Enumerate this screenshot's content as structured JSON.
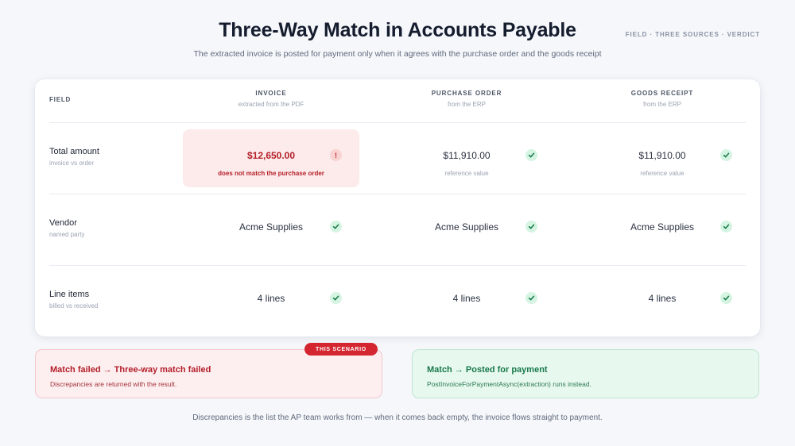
{
  "header": {
    "title": "Three-Way Match in Accounts Payable",
    "subtitle": "The extracted invoice is posted for payment only when it agrees with the purchase order and the goods receipt",
    "crumbs": "FIELD · THREE SOURCES · VERDICT"
  },
  "table": {
    "field_header": "FIELD",
    "columns": [
      {
        "name": "INVOICE",
        "sub": "extracted from the PDF"
      },
      {
        "name": "PURCHASE ORDER",
        "sub": "from the ERP"
      },
      {
        "name": "GOODS RECEIPT",
        "sub": "from the ERP"
      }
    ],
    "rows": [
      {
        "label": "Total amount",
        "hint": "invoice vs order",
        "cells": [
          {
            "value": "$12,650.00",
            "note": "does not match the purchase order",
            "status": "mismatch"
          },
          {
            "value": "$11,910.00",
            "note": "reference value",
            "status": "match"
          },
          {
            "value": "$11,910.00",
            "note": "reference value",
            "status": "match"
          }
        ]
      },
      {
        "label": "Vendor",
        "hint": "named party",
        "cells": [
          {
            "value": "Acme Supplies",
            "status": "match"
          },
          {
            "value": "Acme Supplies",
            "status": "match"
          },
          {
            "value": "Acme Supplies",
            "status": "match"
          }
        ]
      },
      {
        "label": "Line items",
        "hint": "billed vs received",
        "cells": [
          {
            "value": "4 lines",
            "status": "match"
          },
          {
            "value": "4 lines",
            "status": "match"
          },
          {
            "value": "4 lines",
            "status": "match"
          }
        ]
      }
    ]
  },
  "outcomes": {
    "fail": {
      "badge": "THIS SCENARIO",
      "title": "Match failed → Three-way match failed",
      "desc": "Discrepancies are returned with the result."
    },
    "pass": {
      "title": "Match → Posted for payment",
      "desc": "PostInvoiceForPaymentAsync(extraction) runs instead."
    }
  },
  "footer": "Discrepancies is the list the AP team works from — when it comes back empty, the invoice flows straight to payment.",
  "icons": {
    "match": "check-icon",
    "mismatch": "exclamation-icon"
  },
  "colors": {
    "match": "#18794a",
    "mismatch": "#b5202a",
    "accent_badge": "#d42630"
  }
}
